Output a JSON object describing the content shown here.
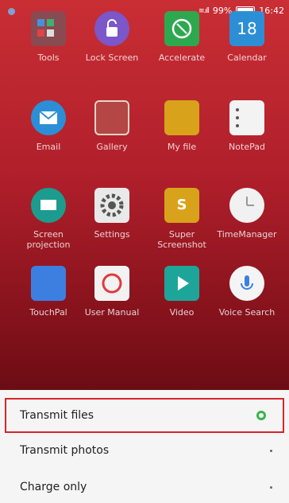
{
  "status": {
    "signal_text": "≡.ıll",
    "battery_percent": "99%",
    "time": "16:42"
  },
  "apps": [
    {
      "label": "Tools",
      "icon": "folder-icon"
    },
    {
      "label": "Lock Screen",
      "icon": "lock-icon"
    },
    {
      "label": "Accelerate",
      "icon": "accelerate-icon"
    },
    {
      "label": "Calendar",
      "icon": "calendar-icon",
      "icon_text": "18"
    },
    {
      "label": "Email",
      "icon": "email-icon"
    },
    {
      "label": "Gallery",
      "icon": "gallery-icon"
    },
    {
      "label": "My file",
      "icon": "file-icon"
    },
    {
      "label": "NotePad",
      "icon": "notepad-icon"
    },
    {
      "label": "Screen projection",
      "icon": "screen-projection-icon"
    },
    {
      "label": "Settings",
      "icon": "settings-icon"
    },
    {
      "label": "Super Screenshot",
      "icon": "screenshot-icon",
      "icon_text": "S"
    },
    {
      "label": "TimeManager",
      "icon": "clock-icon"
    },
    {
      "label": "TouchPal",
      "icon": "touchpal-icon"
    },
    {
      "label": "User Manual",
      "icon": "manual-icon"
    },
    {
      "label": "Video",
      "icon": "video-icon"
    },
    {
      "label": "Voice Search",
      "icon": "mic-icon"
    }
  ],
  "usb_options": [
    {
      "label": "Transmit files",
      "selected": true
    },
    {
      "label": "Transmit photos",
      "selected": false
    },
    {
      "label": "Charge only",
      "selected": false
    }
  ]
}
